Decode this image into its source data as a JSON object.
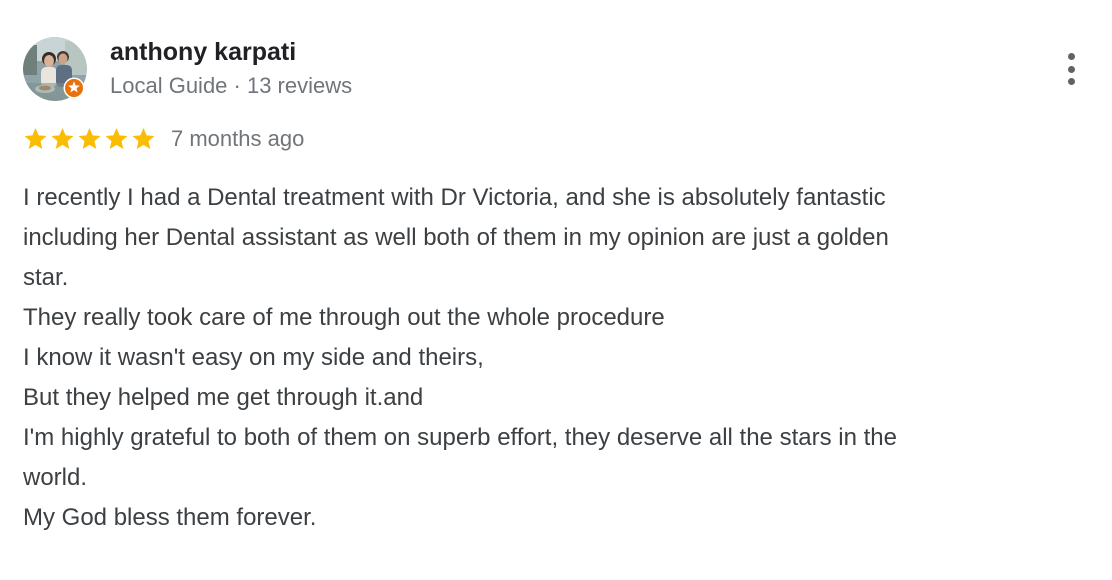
{
  "author": {
    "name": "anthony karpati",
    "meta": "Local Guide · 13 reviews",
    "avatar_icon": "profile-photo",
    "badge_icon": "local-guide-star-badge",
    "badge_color": "#e8710a"
  },
  "review": {
    "rating": 5,
    "rating_max": 5,
    "star_color": "#fbbc04",
    "date": "7 months ago",
    "lines": [
      "I recently I had a Dental treatment with Dr Victoria, and she is absolutely fantastic",
      "including her Dental assistant as well both of them in my opinion are just a golden",
      "star.",
      "They really took care of me through out the whole procedure",
      "I know it wasn't easy on my side and theirs,",
      "But they helped me get through it.and",
      "I'm highly grateful to both of them on superb effort, they deserve all the stars in the",
      "world.",
      "My God bless them forever."
    ]
  },
  "menu": {
    "icon": "more-vert-icon"
  }
}
